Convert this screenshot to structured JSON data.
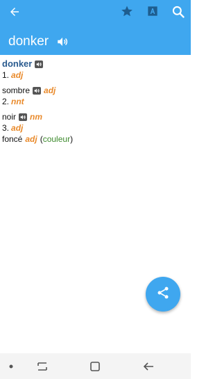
{
  "header": {
    "title": "donker",
    "icons": [
      "back-arrow-icon",
      "star-icon",
      "font-icon",
      "search-icon",
      "speaker-icon"
    ],
    "accent_color": "#3fa7ef"
  },
  "entry": {
    "headword": "donker",
    "senses": [
      {
        "number": "1.",
        "pos": "adj",
        "translation": "sombre",
        "translation_pos": "adj"
      },
      {
        "number": "2.",
        "pos": "nnt",
        "translation": "noir",
        "translation_pos": "nm"
      },
      {
        "number": "3.",
        "pos": "adj",
        "translation": "foncé",
        "translation_pos": "adj",
        "context": "couleur"
      }
    ]
  },
  "fab": {
    "icon": "share-icon"
  },
  "navbar": {
    "icons": [
      "dot-icon",
      "recent-apps-icon",
      "home-icon",
      "back-icon"
    ]
  }
}
